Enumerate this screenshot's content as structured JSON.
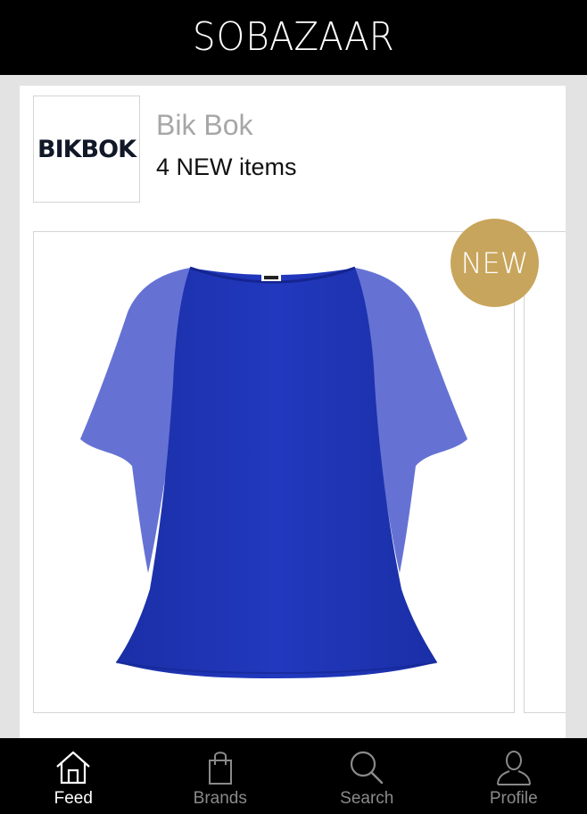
{
  "header": {
    "logo_so": "SO",
    "logo_bazaar": "BAZAAR"
  },
  "brand": {
    "logo_text": "BIKBOK",
    "name": "Bik Bok",
    "count_text": "4 NEW items"
  },
  "product": {
    "badge": "NEW",
    "image": "blue-chiffon-blouse",
    "color": "#1f35b5"
  },
  "tabs": [
    {
      "label": "Feed",
      "icon": "home-icon",
      "active": true
    },
    {
      "label": "Brands",
      "icon": "shopping-bag-icon",
      "active": false
    },
    {
      "label": "Search",
      "icon": "search-icon",
      "active": false
    },
    {
      "label": "Profile",
      "icon": "person-icon",
      "active": false
    }
  ],
  "colors": {
    "badge": "#c8a55c",
    "active_tab": "#ffffff",
    "inactive_tab": "#8a8a8a"
  }
}
